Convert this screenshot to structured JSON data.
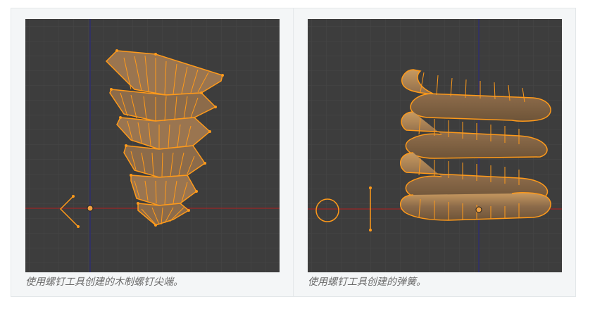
{
  "figures": [
    {
      "caption": "使用螺钉工具创建的木制螺钉尖端。",
      "image_alt": "wood-screw-tip-mesh"
    },
    {
      "caption": "使用螺钉工具创建的弹簧。",
      "image_alt": "spring-coil-mesh"
    }
  ],
  "colors": {
    "viewport_bg": "#3d3d3d",
    "grid": "#474747",
    "x_axis": "#8c2a2a",
    "y_axis": "#2e2e6e",
    "mesh_edge": "#ff9a1a",
    "mesh_fill": "#9a7550",
    "origin": "#f0a040"
  }
}
